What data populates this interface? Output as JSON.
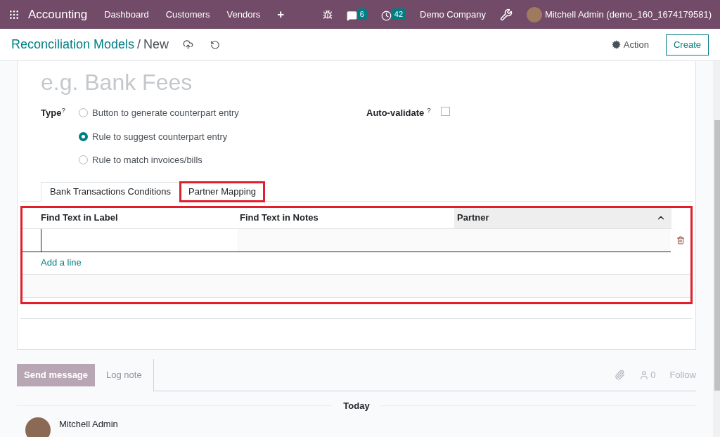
{
  "navbar": {
    "app_name": "Accounting",
    "menu": [
      "Dashboard",
      "Customers",
      "Vendors",
      "+"
    ],
    "messages_count": "6",
    "activities_count": "42",
    "company": "Demo Company",
    "user": "Mitchell Admin (demo_160_1674179581)"
  },
  "control_panel": {
    "breadcrumb": [
      "Reconciliation Models",
      "New"
    ],
    "breadcrumb_separator": "/",
    "action": "Action",
    "create": "Create"
  },
  "form": {
    "name_placeholder": "e.g. Bank Fees",
    "type_label": "Type",
    "type_help": "?",
    "type_options": [
      {
        "label": "Button to generate counterpart entry",
        "selected": false
      },
      {
        "label": "Rule to suggest counterpart entry",
        "selected": true
      },
      {
        "label": "Rule to match invoices/bills",
        "selected": false
      }
    ],
    "auto_validate": {
      "label": "Auto-validate",
      "help": "?",
      "checked": false
    }
  },
  "tabs": [
    {
      "label": "Bank Transactions Conditions",
      "selected": true,
      "highlighted": false
    },
    {
      "label": "Partner Mapping",
      "selected": false,
      "highlighted": true
    }
  ],
  "table": {
    "highlighted": true,
    "columns": [
      {
        "label": "Find Text in Label",
        "sorted": false
      },
      {
        "label": "Find Text in Notes",
        "sorted": false
      },
      {
        "label": "Partner",
        "sorted": true
      }
    ],
    "add_line": "Add a line"
  },
  "chatter": {
    "send_message": "Send message",
    "log_note": "Log note",
    "followers_count": "0",
    "follow": "Follow",
    "date_separator": "Today",
    "messages": [
      {
        "author": "Mitchell Admin"
      }
    ]
  }
}
